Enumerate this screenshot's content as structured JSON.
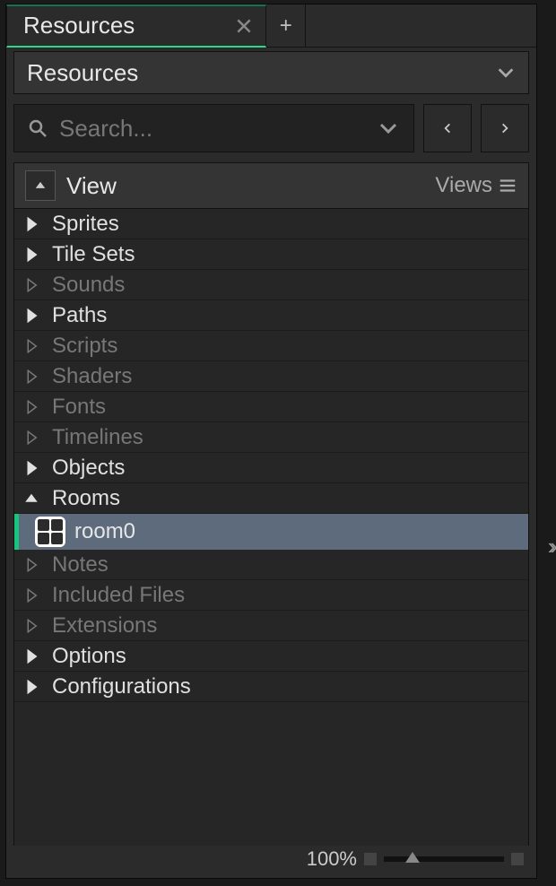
{
  "tab": {
    "label": "Resources"
  },
  "panel": {
    "title": "Resources"
  },
  "search": {
    "placeholder": "Search..."
  },
  "view": {
    "label": "View",
    "menu": "Views"
  },
  "tree": [
    {
      "label": "Sprites",
      "active": true,
      "expanded": false
    },
    {
      "label": "Tile Sets",
      "active": true,
      "expanded": false
    },
    {
      "label": "Sounds",
      "active": false,
      "expanded": false
    },
    {
      "label": "Paths",
      "active": true,
      "expanded": false
    },
    {
      "label": "Scripts",
      "active": false,
      "expanded": false
    },
    {
      "label": "Shaders",
      "active": false,
      "expanded": false
    },
    {
      "label": "Fonts",
      "active": false,
      "expanded": false
    },
    {
      "label": "Timelines",
      "active": false,
      "expanded": false
    },
    {
      "label": "Objects",
      "active": true,
      "expanded": false
    },
    {
      "label": "Rooms",
      "active": true,
      "expanded": true,
      "children": [
        {
          "label": "room0",
          "icon": "room"
        }
      ]
    },
    {
      "label": "Notes",
      "active": false,
      "expanded": false
    },
    {
      "label": "Included Files",
      "active": false,
      "expanded": false
    },
    {
      "label": "Extensions",
      "active": false,
      "expanded": false
    },
    {
      "label": "Options",
      "active": true,
      "expanded": false
    },
    {
      "label": "Configurations",
      "active": true,
      "expanded": false
    }
  ],
  "status": {
    "zoom": "100%"
  }
}
